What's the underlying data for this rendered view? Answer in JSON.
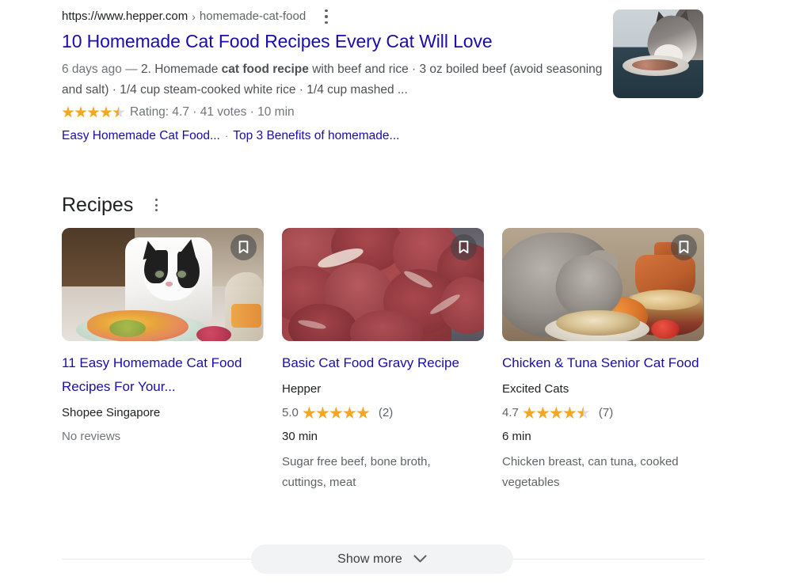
{
  "organic_result": {
    "url_domain": "https://www.hepper.com",
    "url_separator": "›",
    "url_breadcrumb": "homemade-cat-food",
    "menu_icon": "kebab-menu-icon",
    "title": "10 Homemade Cat Food Recipes Every Cat Will Love",
    "snippet_date": "6 days ago",
    "snippet_dash": "—",
    "snippet_part1": "2. Homemade ",
    "snippet_bold": "cat food recipe",
    "snippet_part2": " with beef and rice · 3 oz boiled beef (avoid seasoning and salt) · 1/4 cup steam-cooked white rice · 1/4 cup mashed ...",
    "rating_stars": "4.5",
    "rating_text": "Rating: 4.7 · 41 votes · 10 min",
    "sitelinks": [
      {
        "label": "Easy Homemade Cat Food..."
      },
      {
        "label": "Top 3 Benefits of homemade..."
      }
    ],
    "sitelink_separator": "·",
    "thumbnail_alt": "cat-eating-from-bowl-thumbnail"
  },
  "recipes_section": {
    "heading": "Recipes",
    "menu_icon": "kebab-menu-icon",
    "bookmark_icon": "bookmark-icon",
    "cards": [
      {
        "image_alt": "black-and-white-cat-at-dinner-table",
        "title": "11 Easy Homemade Cat Food Recipes For Your...",
        "source": "Shopee Singapore",
        "rating_value": "",
        "rating_stars": "0",
        "rating_count": "",
        "no_reviews": "No reviews",
        "time": "",
        "ingredients": ""
      },
      {
        "image_alt": "raw-beef-chunks",
        "title": "Basic Cat Food Gravy Recipe",
        "source": "Hepper",
        "rating_value": "5.0",
        "rating_stars": "5",
        "rating_count": "(2)",
        "no_reviews": "",
        "time": "30 min",
        "ingredients": "Sugar free beef, bone broth, cuttings, meat"
      },
      {
        "image_alt": "grey-cat-eating-food",
        "title": "Chicken & Tuna Senior Cat Food",
        "source": "Excited Cats",
        "rating_value": "4.7",
        "rating_stars": "4.5",
        "rating_count": "(7)",
        "no_reviews": "",
        "time": "6 min",
        "ingredients": "Chicken breast, can tuna, cooked vegetables"
      }
    ]
  },
  "show_more": {
    "label": "Show more",
    "chevron_icon": "chevron-down-icon"
  },
  "colors": {
    "link": "#1a0dab",
    "star": "#f5a623",
    "text_primary": "#202124",
    "text_secondary": "#5f6368",
    "pill_bg": "#f1f3f4"
  }
}
